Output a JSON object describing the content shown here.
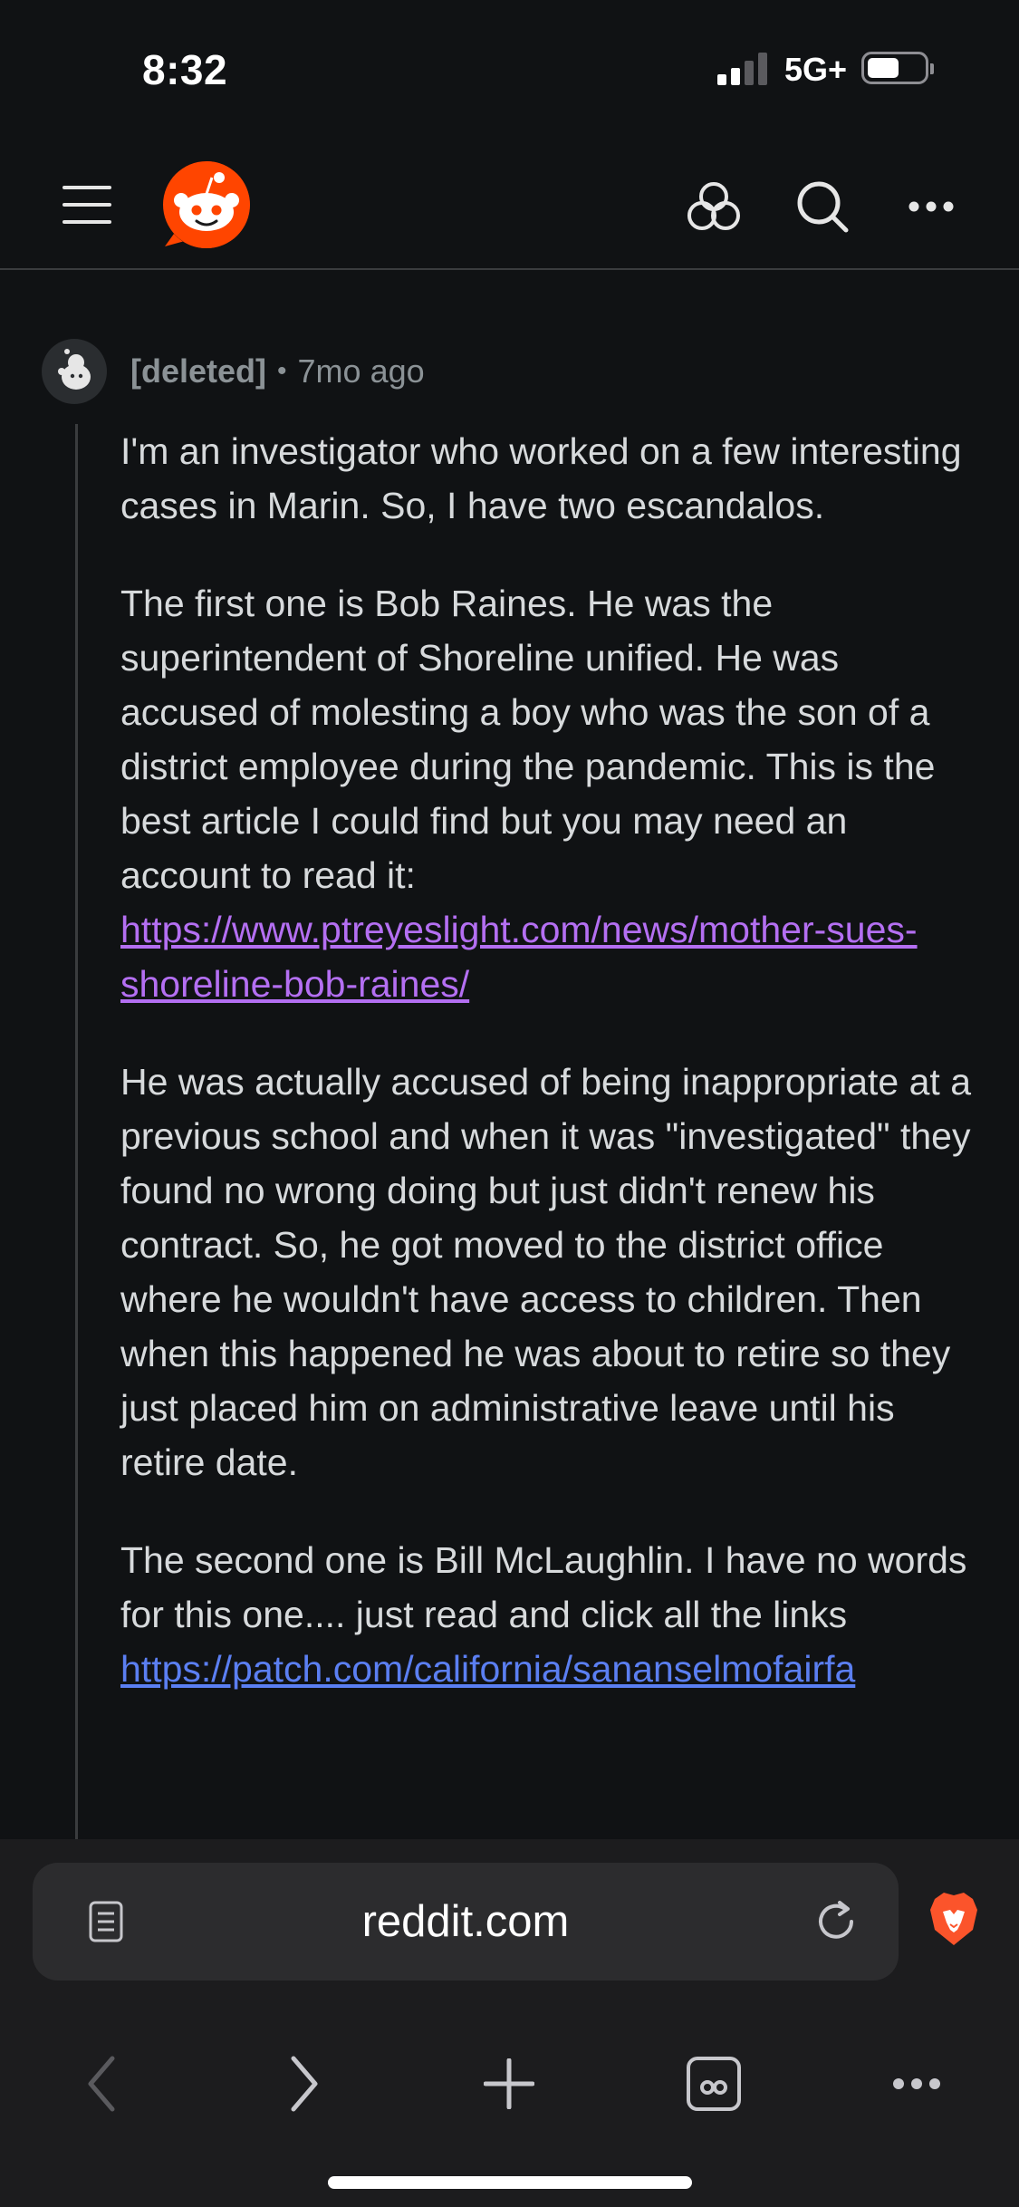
{
  "status_bar": {
    "time": "8:32",
    "network": "5G+"
  },
  "comment": {
    "author": "[deleted]",
    "separator": "•",
    "age": "7mo ago",
    "paragraphs": [
      "I'm an investigator who worked on a few interesting cases in Marin. So, I have two escandalos.",
      "The first one is Bob Raines. He was the superintendent of Shoreline unified. He was accused of molesting a boy who was the son of a district employee during the pandemic. This is the best article I could find but you may need an account to read it:",
      "He was actually accused of being inappropriate at a previous school and when it was \"investigated\" they found no wrong doing but just didn't renew his contract. So, he got moved to the district office where he wouldn't have access to children. Then when this happened he was about to retire so they just placed him on administrative leave until his retire date.",
      "The second one is Bill McLaughlin. I have no words for this one.... just read and click all the links"
    ],
    "link1": "https://www.ptreyeslight.com/news/mother-sues-shoreline-bob-raines/",
    "link2": "https://patch.com/california/sananselmofairfa"
  },
  "browser": {
    "url": "reddit.com"
  },
  "icons": {
    "menu": "hamburger-icon",
    "logo": "reddit-logo",
    "apps": "apps-icon",
    "search": "search-icon",
    "more": "more-icon",
    "reader": "reader-icon",
    "reload": "reload-icon",
    "brave": "brave-lion-icon",
    "back": "chevron-left-icon",
    "forward": "chevron-right-icon",
    "new_tab": "plus-icon",
    "tabs": "tabs-icon",
    "menu_more": "more-icon"
  },
  "colors": {
    "background": "#101214",
    "reddit_orange": "#ff4500",
    "link_visited": "#b46ff2",
    "link": "#5b7ff2",
    "brave_orange": "#fb542b"
  }
}
